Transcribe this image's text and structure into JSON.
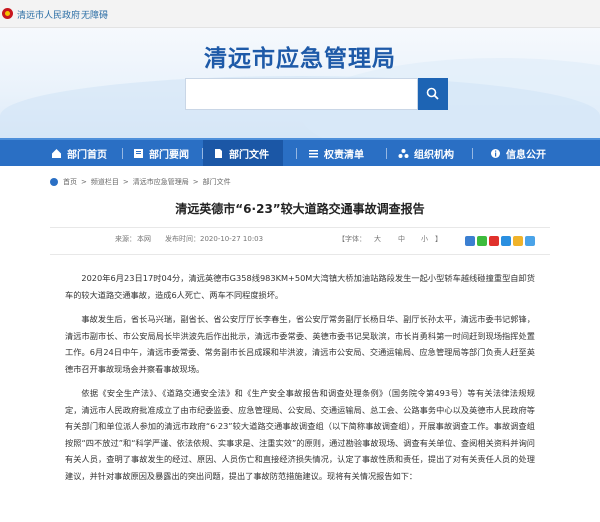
{
  "topbar": {
    "gov_link": "清远市人民政府",
    "accessibility": "无障碍"
  },
  "site": {
    "title": "清远市应急管理局"
  },
  "search": {
    "placeholder": ""
  },
  "nav": [
    {
      "label": "部门首页",
      "icon": "home-icon"
    },
    {
      "label": "部门要闻",
      "icon": "news-icon"
    },
    {
      "label": "部门文件",
      "icon": "document-icon"
    },
    {
      "label": "权责清单",
      "icon": "list-icon"
    },
    {
      "label": "组织机构",
      "icon": "org-icon"
    },
    {
      "label": "信息公开",
      "icon": "info-icon"
    }
  ],
  "breadcrumb": [
    "首页",
    "频道栏目",
    "清远市应急管理局",
    "部门文件"
  ],
  "article": {
    "title": "清远英德市“6·23”较大道路交通事故调查报告",
    "source_label": "来源：",
    "source_value": "本网",
    "date": "发布时间：2020-10-27 10:03",
    "font_label": "【字体：",
    "font_sizes": [
      "大",
      "中",
      "小"
    ],
    "font_end": "】",
    "paragraphs": [
      "2020年6月23日17时04分，清远英德市G358线983KM+50M大湾镇大桥加油站路段发生一起小型轿车越线碰撞重型自卸货车的较大道路交通事故，造成6人死亡、两车不同程度损坏。",
      "事故发生后，省长马兴瑞，副省长、省公安厅厅长李春生，省公安厅常务副厅长杨日华、副厅长孙太平，清远市委书记郭锋，清远市副市长、市公安局局长毕洪波先后作出批示，清远市委常委、英德市委书记吴耿滨，市长肖勇科第一时间赶到现场指挥处置工作。6月24日中午，清远市委常委、常务副市长吕成蹊和毕洪波，清远市公安局、交通运输局、应急管理局等部门负责人赶至英德市召开事故现场会并察看事故现场。",
      "依据《安全生产法》、《道路交通安全法》和《生产安全事故报告和调查处理条例》（国务院令第493号）等有关法律法规规定，清远市人民政府批准成立了由市纪委监委、应急管理局、公安局、交通运输局、总工会、公路事务中心以及英德市人民政府等有关部门和单位派人参加的清远市政府“6·23”较大道路交通事故调查组（以下简称事故调查组），开展事故调查工作。事故调查组按照“四不放过”和“科学严谨、依法依规、实事求是、注重实效”的原则，通过勘验事故现场、调查有关单位、查阅相关资料并询问有关人员，查明了事故发生的经过、原因、人员伤亡和直接经济损失情况，认定了事故性质和责任，提出了对有关责任人员的处理建议，并针对事故原因及暴露出的突出问题，提出了事故防范措施建议。现将有关情况报告如下："
    ]
  },
  "colors": {
    "nav_bg": "#2a6fc4",
    "nav_active": "#1b57a6",
    "title_blue": "#1e5aa8"
  }
}
